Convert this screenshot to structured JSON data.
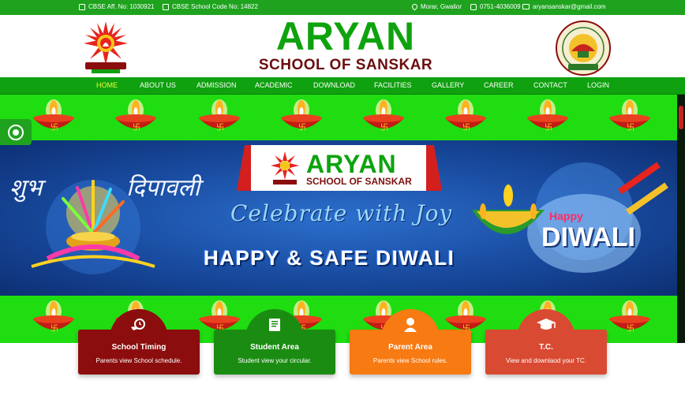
{
  "topbar": {
    "affiliation": "CBSE Aff. No: 1030921",
    "school_code": "CBSE School Code No: 14822",
    "location": "Morar, Gwalior",
    "phone": "0751-4036009",
    "email": "aryansanskar@gmail.com"
  },
  "header": {
    "title": "ARYAN",
    "subtitle": "SCHOOL OF SANSKAR"
  },
  "nav": {
    "items": [
      "HOME",
      "ABOUT US",
      "ADMISSION",
      "ACADEMIC",
      "DOWNLOAD",
      "FACILITIES",
      "GALLERY",
      "CAREER",
      "CONTACT",
      "LOGIN"
    ],
    "active": "HOME"
  },
  "banner": {
    "school_title": "ARYAN",
    "school_subtitle": "SCHOOL OF SANSKAR",
    "tagline": "Celebrate with Joy",
    "headline": "HAPPY & SAFE DIWALI",
    "shubh": "शुभ",
    "deepavali": "दिपावली",
    "happy": "Happy",
    "diwali": "DIWALI"
  },
  "cards": [
    {
      "title": "School Timing",
      "desc": "Parents view School schedule.",
      "icon": "hand-clock-icon"
    },
    {
      "title": "Student Area",
      "desc": "Student view your circular.",
      "icon": "book-icon"
    },
    {
      "title": "Parent Area",
      "desc": "Parents view School rules.",
      "icon": "user-icon"
    },
    {
      "title": "T.C.",
      "desc": "View and downlaod your TC.",
      "icon": "graduation-cap-icon"
    }
  ],
  "colors": {
    "green": "#1fa31f",
    "banner_green": "#1fdd11",
    "maroon": "#8b0d0d",
    "orange": "#f77a12",
    "red": "#d94a32",
    "active_nav": "#f2ff3a"
  }
}
